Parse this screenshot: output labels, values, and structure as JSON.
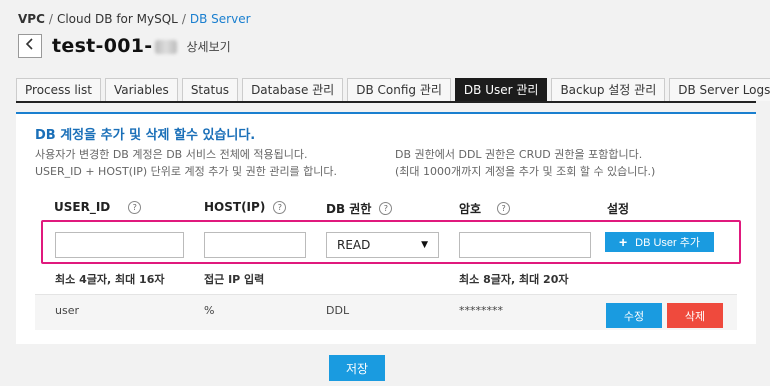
{
  "breadcrumb": {
    "items": [
      "VPC",
      "Cloud DB for MySQL",
      "DB Server"
    ],
    "separator": "/"
  },
  "header": {
    "server_name": "test-001-",
    "detail_label": "상세보기",
    "back_icon": "chevron-left-icon"
  },
  "tabs": [
    {
      "label": "Process list",
      "active": false
    },
    {
      "label": "Variables",
      "active": false
    },
    {
      "label": "Status",
      "active": false
    },
    {
      "label": "Database 관리",
      "active": false
    },
    {
      "label": "DB Config 관리",
      "active": false
    },
    {
      "label": "DB User 관리",
      "active": true
    },
    {
      "label": "Backup 설정 관리",
      "active": false
    },
    {
      "label": "DB Server Logs",
      "active": false
    }
  ],
  "info": {
    "title": "DB 계정을 추가 및 삭제 할수 있습니다.",
    "left_line1": "사용자가 변경한 DB 계정은 DB 서비스 전체에 적용됩니다.",
    "left_line2": "USER_ID + HOST(IP) 단위로 계정 추가 및 권한 관리를 합니다.",
    "right_line1": "DB 권한에서 DDL 권한은 CRUD 권한을 포함합니다.",
    "right_line2": "(최대 1000개까지 계정을 추가 및 조회 할 수 있습니다.)"
  },
  "columns": {
    "user_id": "USER_ID",
    "host": "HOST(IP)",
    "privilege": "DB 권한",
    "password": "암호",
    "settings": "설정",
    "help_glyph": "?"
  },
  "form": {
    "user_id_value": "",
    "host_value": "",
    "privilege_selected": "READ",
    "password_value": "",
    "add_button_label": "DB User 추가",
    "add_icon": "plus-icon"
  },
  "hints": {
    "user_id": "최소 4글자, 최대 16자",
    "host": "접근 IP 입력",
    "password": "최소 8글자, 최대 20자"
  },
  "users": [
    {
      "user_id": "user",
      "host": "%",
      "privilege": "DDL",
      "password": "********",
      "edit_label": "수정",
      "delete_label": "삭제"
    }
  ],
  "footer": {
    "save_label": "저장"
  },
  "colors": {
    "accent": "#1a9be0",
    "title_blue": "#1a6fb8",
    "delete_red": "#ef4a3d",
    "highlight": "#e0197d",
    "active_tab": "#1c1c1c"
  }
}
